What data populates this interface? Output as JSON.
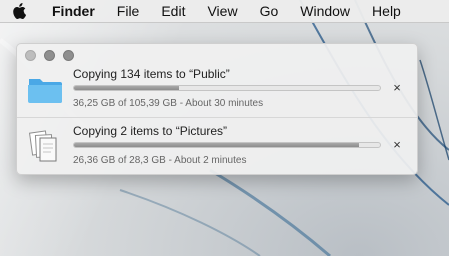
{
  "menubar": {
    "app": "Finder",
    "items": [
      "File",
      "Edit",
      "View",
      "Go",
      "Window",
      "Help"
    ]
  },
  "window": {
    "traffic_lights": [
      "close-light",
      "minimize-light",
      "zoom-light"
    ],
    "copies": [
      {
        "title": "Copying 134 items to “Public”",
        "status": "36,25 GB of 105,39 GB - About 30 minutes",
        "progress": 0.344,
        "icon": "folder-icon"
      },
      {
        "title": "Copying 2 items to “Pictures”",
        "status": "26,36 GB of 28,3 GB - About 2 minutes",
        "progress": 0.931,
        "icon": "documents-icon"
      }
    ],
    "close_label": "×"
  },
  "colors": {
    "folder": "#5ab4ea",
    "progress_fill": "#9a9a9a",
    "progress_track": "#e7e7e7"
  }
}
